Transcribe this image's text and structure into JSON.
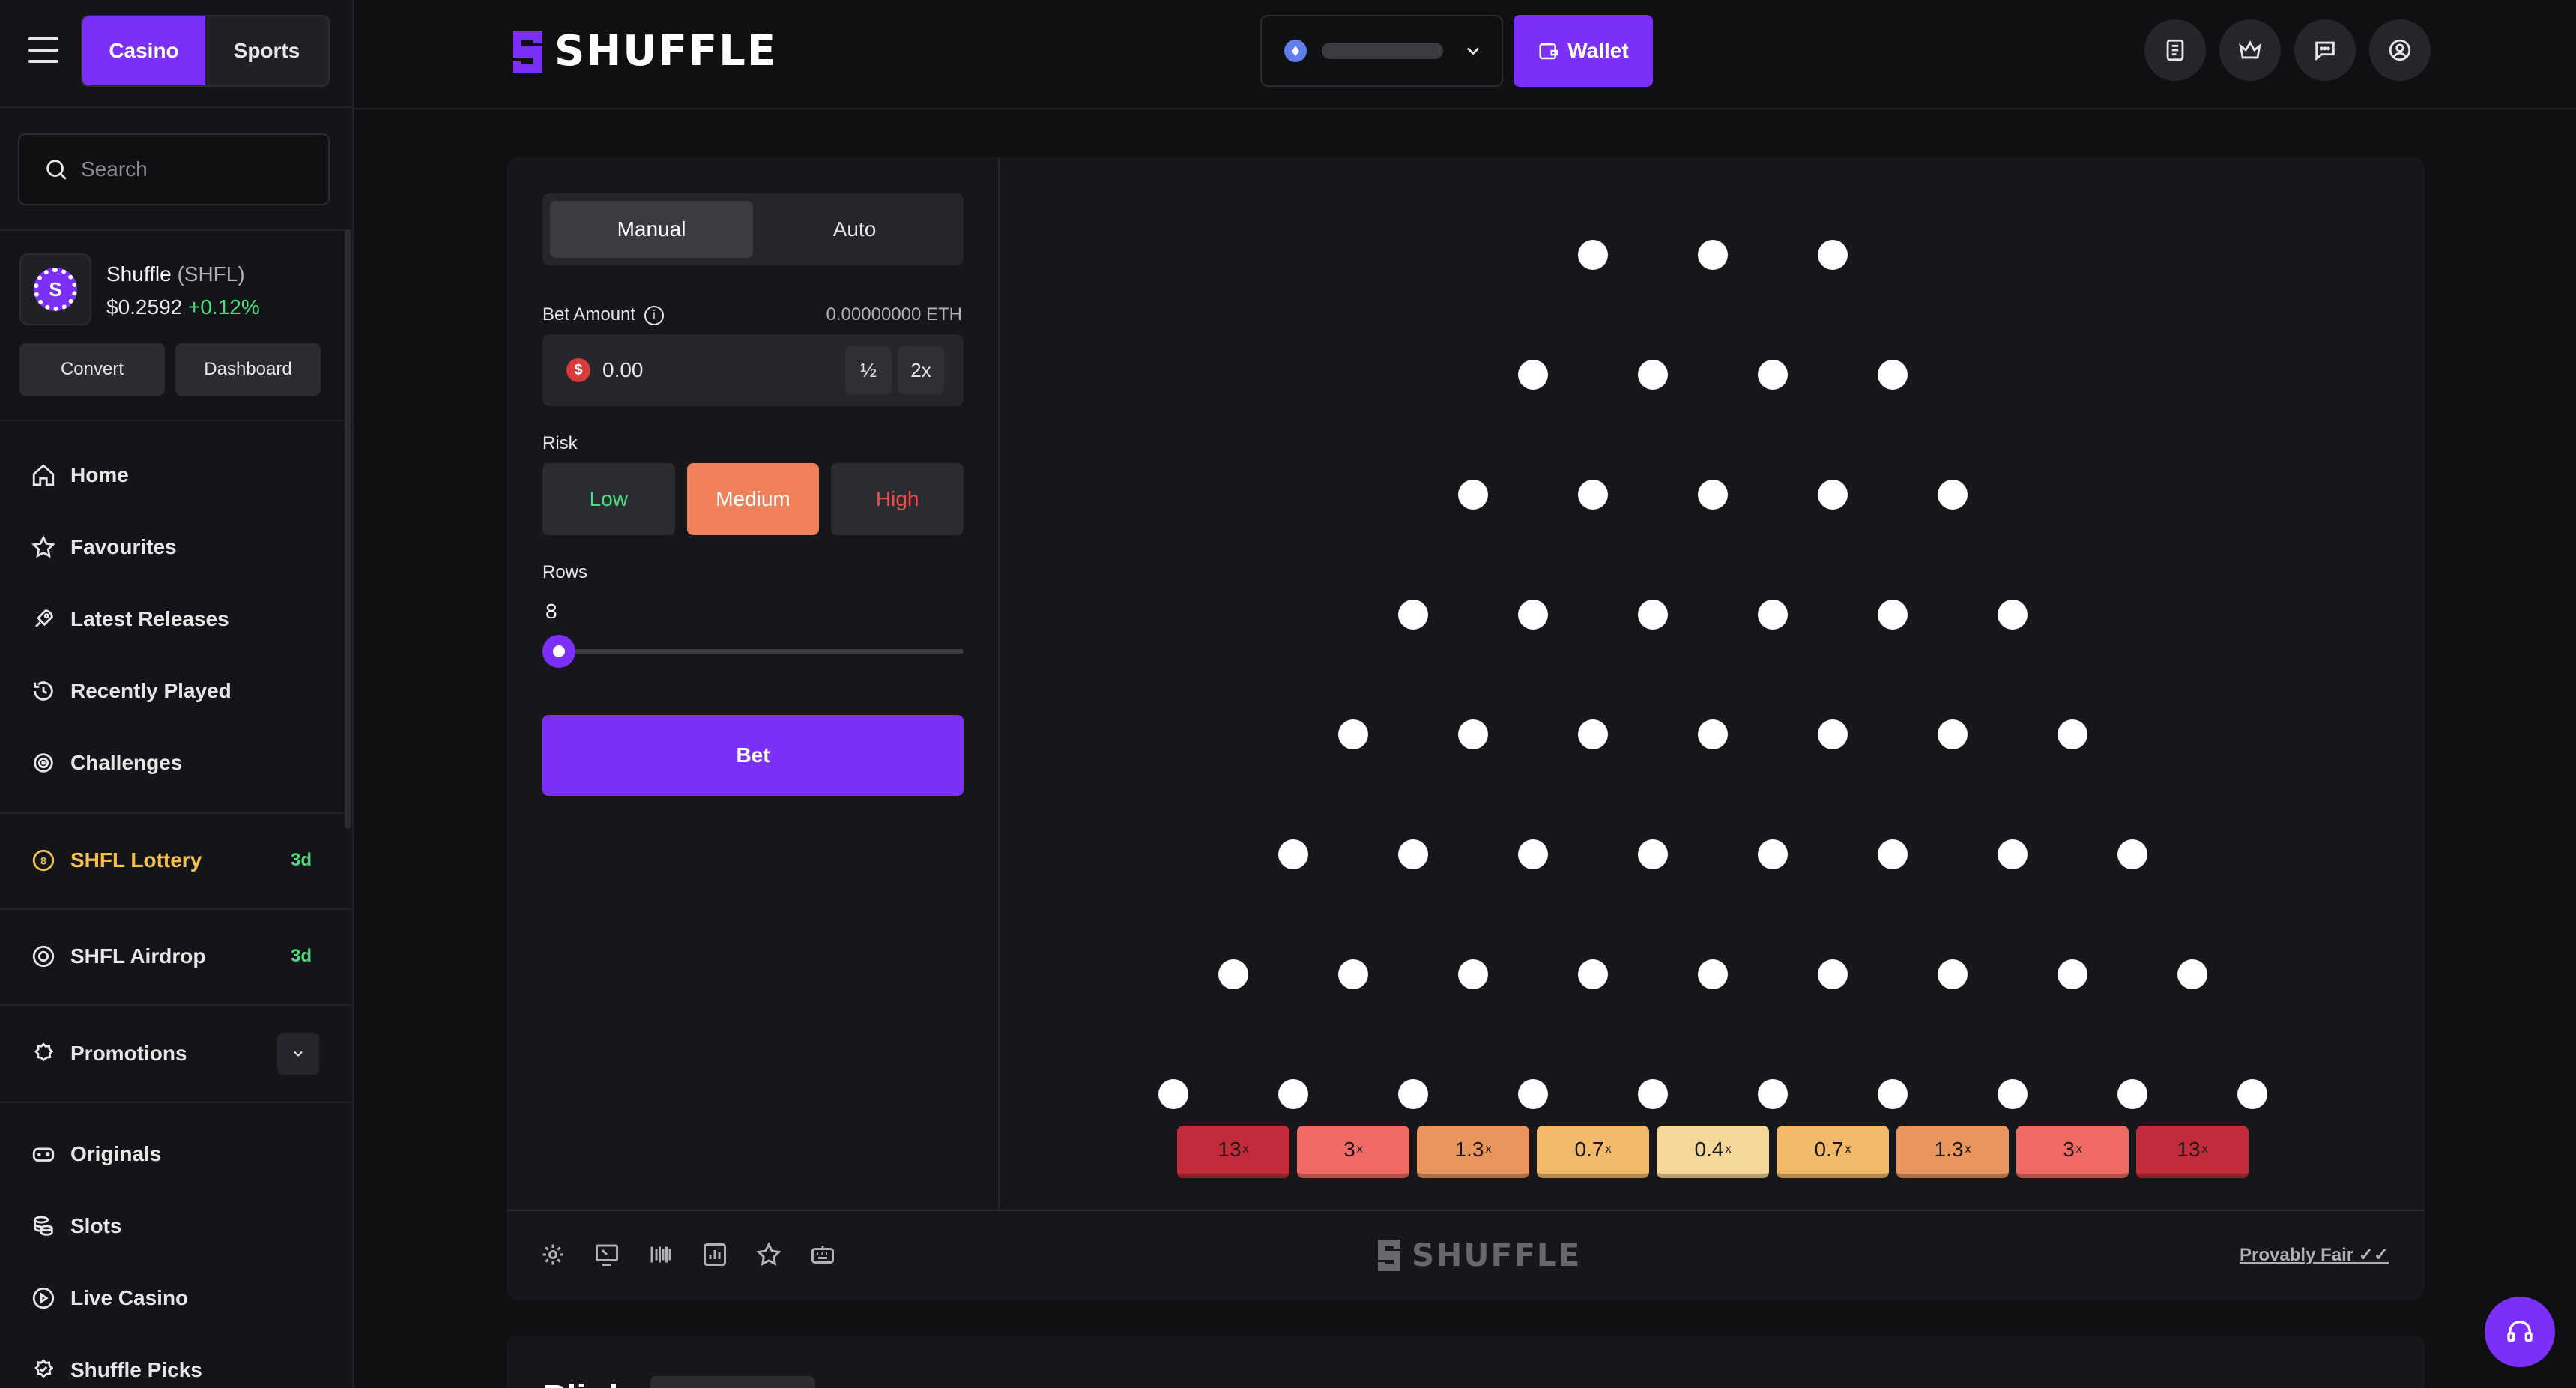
{
  "sidebar": {
    "modes": [
      "Casino",
      "Sports"
    ],
    "active_mode": "Casino",
    "search_placeholder": "Search",
    "token": {
      "name": "Shuffle",
      "symbol": "(SHFL)",
      "price": "$0.2592",
      "change": "+0.12%",
      "convert_label": "Convert",
      "dashboard_label": "Dashboard"
    },
    "nav_main": [
      {
        "label": "Home",
        "icon": "home-icon"
      },
      {
        "label": "Favourites",
        "icon": "star-icon"
      },
      {
        "label": "Latest Releases",
        "icon": "rocket-icon"
      },
      {
        "label": "Recently Played",
        "icon": "history-icon"
      },
      {
        "label": "Challenges",
        "icon": "target-icon"
      }
    ],
    "lottery": {
      "label": "SHFL Lottery",
      "badge": "3d"
    },
    "airdrop": {
      "label": "SHFL Airdrop",
      "badge": "3d"
    },
    "promotions": {
      "label": "Promotions"
    },
    "nav_games": [
      {
        "label": "Originals",
        "icon": "gamepad-icon"
      },
      {
        "label": "Slots",
        "icon": "coins-icon"
      },
      {
        "label": "Live Casino",
        "icon": "play-circle-icon"
      },
      {
        "label": "Shuffle Picks",
        "icon": "badge-check-icon"
      }
    ]
  },
  "header": {
    "brand": "SHUFFLE",
    "wallet_label": "Wallet",
    "icons": [
      "receipt-icon",
      "crown-icon",
      "chat-icon",
      "user-icon"
    ]
  },
  "game": {
    "tabs": [
      "Manual",
      "Auto"
    ],
    "active_tab": "Manual",
    "bet_amount_label": "Bet Amount",
    "balance": "0.00000000 ETH",
    "bet_value": "0.00",
    "half_label": "½",
    "double_label": "2x",
    "risk_label": "Risk",
    "risk_options": [
      "Low",
      "Medium",
      "High"
    ],
    "active_risk": "Medium",
    "rows_label": "Rows",
    "rows_value": "8",
    "rows_slider_fraction": 0.0,
    "bet_button": "Bet",
    "multipliers": [
      "13",
      "3",
      "1.3",
      "0.7",
      "0.4",
      "0.7",
      "1.3",
      "3",
      "13"
    ],
    "multiplier_suffix": "x",
    "multiplier_colors": [
      "#c42b3a",
      "#ee6a62",
      "#e8955e",
      "#f2b96a",
      "#f6d79a",
      "#f2b96a",
      "#e8955e",
      "#ee6a62",
      "#c42b3a"
    ],
    "footer_brand": "SHUFFLE",
    "provably_fair": "Provably Fair",
    "footer_icons": [
      "settings-icon",
      "theatre-mode-icon",
      "barcode-icon",
      "stats-icon",
      "star-icon",
      "keyboard-icon"
    ]
  },
  "next_section": {
    "title": "Plinko"
  },
  "colors": {
    "accent": "#7b2ff7",
    "medium_risk": "#f0805a",
    "low_risk": "#4ade80",
    "high_risk": "#f04a4a"
  }
}
